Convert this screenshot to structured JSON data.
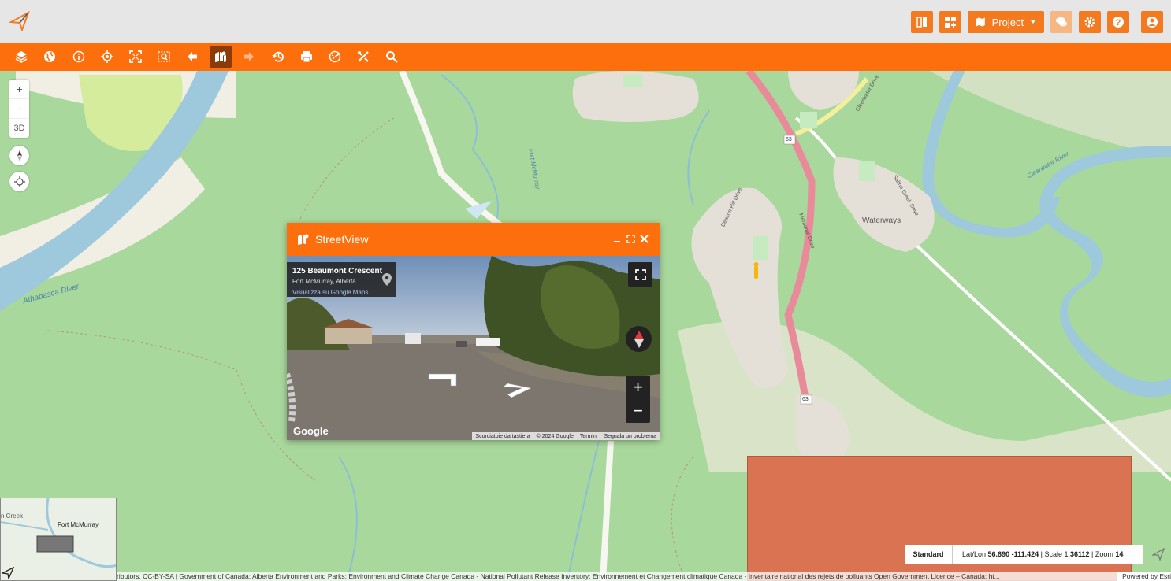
{
  "topbar": {
    "project_label": "Project",
    "buttons": [
      "split-icon",
      "add-widget-icon",
      "map-icon",
      "chat-icon",
      "gear-icon",
      "help-icon",
      "user-icon"
    ]
  },
  "toolbar": {
    "tools": [
      "layers-icon",
      "globe-icon",
      "info-icon",
      "locate-icon",
      "fullextent-icon",
      "zoom-select-icon",
      "back-icon",
      "streetview-icon",
      "forward-icon",
      "history-icon",
      "print-icon",
      "measure-icon",
      "tools-icon",
      "search-icon"
    ]
  },
  "mapcontrols": {
    "zoom_in": "+",
    "zoom_out": "−",
    "three_d": "3D"
  },
  "maplabels": {
    "athabasca": "Athabasca River",
    "fortmcmurray": "Fort McMurray",
    "waterways": "Waterways",
    "memorial": "Memorial Drive",
    "beacon": "Beacon Hill Drive",
    "saline": "Saline Creek Drive",
    "clearwater": "Clearwater River",
    "clearwater_dr": "Clearwater Drive",
    "hwy": "63"
  },
  "streetview": {
    "title": "StreetView",
    "address_line1": "125 Beaumont Crescent",
    "address_line2": "Fort McMurray, Alberta",
    "address_link": "Visualizza su Google Maps",
    "google": "Google",
    "attribution": [
      "Scorciatoie da tastiera",
      "© 2024 Google",
      "Termini",
      "Segnala un problema"
    ]
  },
  "minimap": {
    "label": "Fort McMurray",
    "creek": "n Creek"
  },
  "status": {
    "mode": "Standard",
    "latlon_label": "Lat/Lon",
    "latlon": "56.690 -111.424",
    "scale_label": "Scale 1:",
    "scale": "36112",
    "zoom_label": "Zoom",
    "zoom": "14"
  },
  "footer": {
    "attribution": "ributors, CC-BY-SA | Government of Canada; Alberta Environment and Parks; Environment and Climate Change Canada - National Pollutant Release Inventory; Environnement et Changement climatique Canada - Inventaire national des rejets de polluants Open Government Licence – Canada: ht...",
    "powered": "Powered by Esri"
  },
  "colors": {
    "accent": "#fd6f0c",
    "highlight_area": "#d97352",
    "water": "#9ec8dc",
    "forest": "#a9d89c"
  }
}
